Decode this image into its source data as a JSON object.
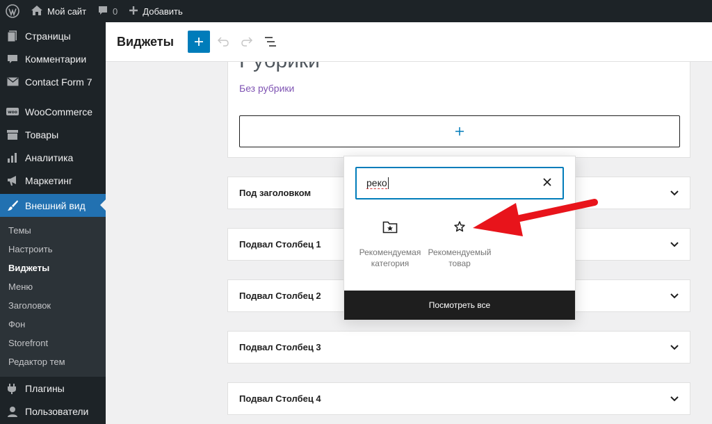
{
  "adminbar": {
    "site_name": "Мой сайт",
    "comments_count": "0",
    "add_new": "Добавить"
  },
  "sidebar": {
    "items_top": [
      {
        "label": "Страницы",
        "icon": "pages-icon"
      },
      {
        "label": "Комментарии",
        "icon": "comments-icon"
      },
      {
        "label": "Contact Form 7",
        "icon": "mail-icon"
      }
    ],
    "items_mid": [
      {
        "label": "WooCommerce",
        "icon": "woo-icon"
      },
      {
        "label": "Товары",
        "icon": "products-icon"
      },
      {
        "label": "Аналитика",
        "icon": "analytics-icon"
      },
      {
        "label": "Маркетинг",
        "icon": "megaphone-icon"
      }
    ],
    "active": {
      "label": "Внешний вид",
      "icon": "brush-icon"
    },
    "submenu": [
      "Темы",
      "Настроить",
      "Виджеты",
      "Меню",
      "Заголовок",
      "Фон",
      "Storefront",
      "Редактор тем"
    ],
    "submenu_current": "Виджеты",
    "items_bottom": [
      {
        "label": "Плагины",
        "icon": "plugins-icon"
      },
      {
        "label": "Пользователи",
        "icon": "users-icon"
      }
    ]
  },
  "header": {
    "title": "Виджеты"
  },
  "canvas": {
    "heading_partial": "Рубрики",
    "category_link": "Без рубрики",
    "widget_areas": [
      "Под заголовком",
      "Подвал Столбец 1",
      "Подвал Столбец 2",
      "Подвал Столбец 3",
      "Подвал Столбец 4"
    ]
  },
  "inserter": {
    "search_value": "реко",
    "results": [
      {
        "label": "Рекомендуемая категория",
        "icon": "folder-star-icon"
      },
      {
        "label": "Рекомендуемый товар",
        "icon": "star-icon"
      }
    ],
    "view_all": "Посмотреть все"
  },
  "colors": {
    "accent": "#007cba",
    "admin_dark": "#1d2327",
    "active_menu": "#2271b1",
    "link_purple": "#7f54b3",
    "annotation_arrow": "#e8141b"
  }
}
